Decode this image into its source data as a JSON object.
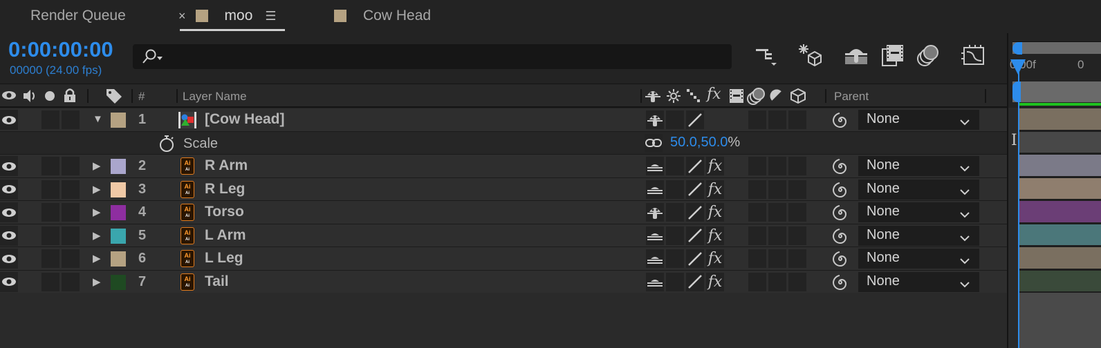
{
  "tabs": [
    {
      "label": "Render Queue",
      "active": false
    },
    {
      "label": "moo",
      "active": true,
      "swatch": "#b5a282"
    },
    {
      "label": "Cow Head",
      "active": false,
      "swatch": "#b5a282"
    }
  ],
  "tab_icons": {
    "close": "×",
    "menu": "☰"
  },
  "header": {
    "timecode": "0:00:00:00",
    "frames": "00000 (24.00 fps)",
    "search_placeholder": ""
  },
  "toolbar": [
    {
      "icon": "composition-flowchart-icon"
    },
    {
      "icon": "draft-3d-icon"
    },
    {
      "icon": "shy-layers-icon"
    },
    {
      "icon": "frame-blending-icon"
    },
    {
      "icon": "motion-blur-icon"
    },
    {
      "icon": "graph-editor-icon"
    }
  ],
  "columns": {
    "number": "#",
    "layer_name": "Layer Name",
    "parent": "Parent"
  },
  "layers": [
    {
      "num": "1",
      "name": "[Cow Head]",
      "type": "precomp",
      "label_color": "#b5a282",
      "expanded": true,
      "shy_icon": "shy-off",
      "fx": false,
      "parent": "None",
      "bar_color": "#7a6f60"
    },
    {
      "num": "2",
      "name": "R Arm",
      "type": "ai",
      "label_color": "#aaa6cc",
      "expanded": false,
      "shy_icon": "shy-on",
      "fx": true,
      "parent": "None",
      "bar_color": "#7b7a88"
    },
    {
      "num": "3",
      "name": "R Leg",
      "type": "ai",
      "label_color": "#f0c9a6",
      "expanded": false,
      "shy_icon": "shy-on",
      "fx": true,
      "parent": "None",
      "bar_color": "#8f7e6e"
    },
    {
      "num": "4",
      "name": "Torso",
      "type": "ai",
      "label_color": "#8e2ea0",
      "expanded": false,
      "shy_icon": "shy-off",
      "fx": true,
      "parent": "None",
      "bar_color": "#6b3e76"
    },
    {
      "num": "5",
      "name": "L Arm",
      "type": "ai",
      "label_color": "#3aa6ad",
      "expanded": false,
      "shy_icon": "shy-on",
      "fx": true,
      "parent": "None",
      "bar_color": "#4b777a"
    },
    {
      "num": "6",
      "name": "L Leg",
      "type": "ai",
      "label_color": "#b5a282",
      "expanded": false,
      "shy_icon": "shy-on",
      "fx": true,
      "parent": "None",
      "bar_color": "#7a6f60"
    },
    {
      "num": "7",
      "name": "Tail",
      "type": "ai",
      "label_color": "#1f4a22",
      "expanded": false,
      "shy_icon": "shy-on",
      "fx": true,
      "parent": "None",
      "bar_color": "#3a4a3a"
    }
  ],
  "property": {
    "name": "Scale",
    "value": "50.0,50.0",
    "unit": "%"
  },
  "timeline": {
    "ruler_label": "0:00f",
    "ruler_label_2": "0",
    "playhead_color": "#2d8ceb"
  }
}
